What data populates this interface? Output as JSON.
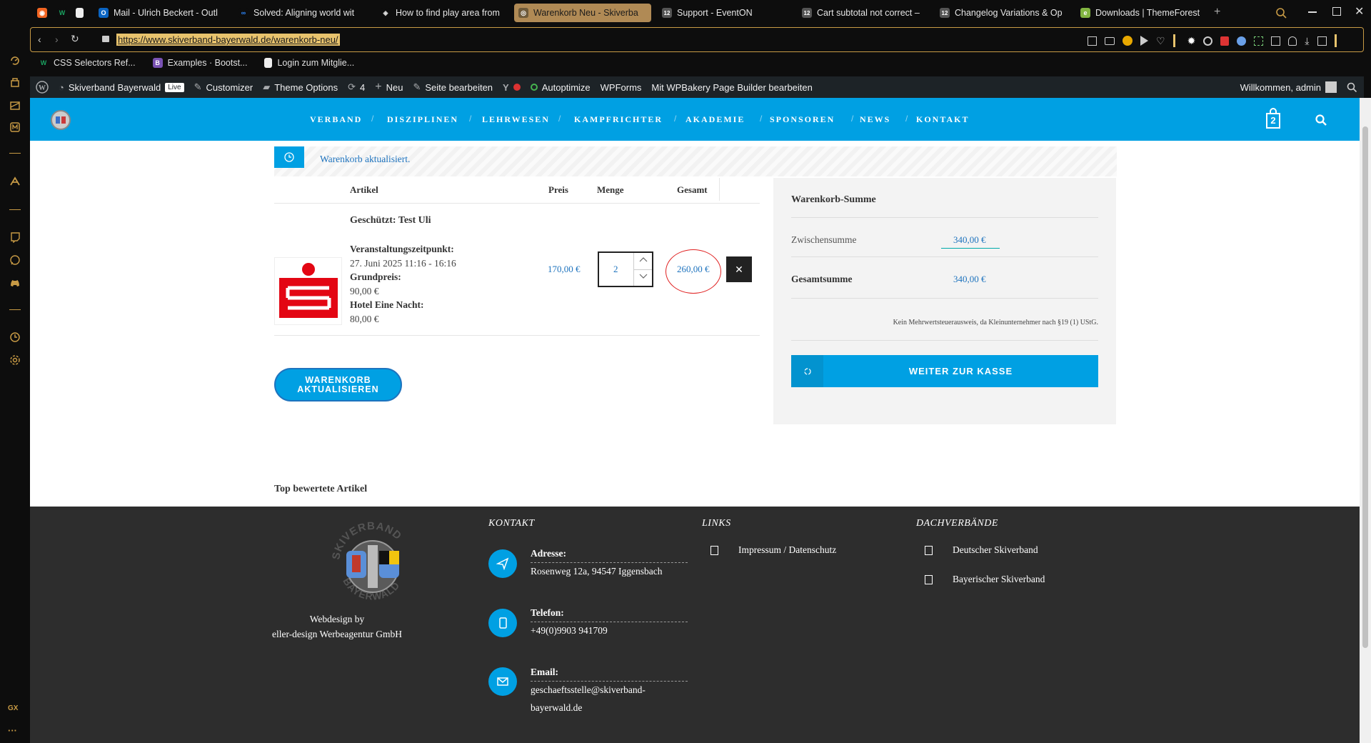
{
  "browser": {
    "tabs": [
      {
        "label": ""
      },
      {
        "label": ""
      },
      {
        "label": ""
      },
      {
        "label": "Mail - Ulrich Beckert - Outl"
      },
      {
        "label": "Solved: Aligning world wit"
      },
      {
        "label": "How to find play area from"
      },
      {
        "label": "Warenkorb Neu - Skiverba"
      },
      {
        "label": "Support - EventON"
      },
      {
        "label": "Cart subtotal not correct –"
      },
      {
        "label": "Changelog Variations & Op"
      },
      {
        "label": "Downloads | ThemeForest"
      }
    ],
    "url": "https://www.skiverband-bayerwald.de/warenkorb-neu/",
    "bookmarks": [
      "CSS Selectors Ref...",
      "Examples · Bootst...",
      "Login zum Mitglie..."
    ],
    "sidebar_gx": "GX",
    "sidebar_more": "···"
  },
  "wpbar": {
    "site": "Skiverband Bayerwald",
    "live": "Live",
    "customizer": "Customizer",
    "theme_options": "Theme Options",
    "updates": "4",
    "new": "Neu",
    "edit_page": "Seite bearbeiten",
    "autoptimize": "Autoptimize",
    "wpforms": "WPForms",
    "wpbakery": "Mit WPBakery Page Builder bearbeiten",
    "welcome": "Willkommen, admin"
  },
  "nav": {
    "items": [
      "VERBAND",
      "DISZIPLINEN",
      "LEHRWESEN",
      "KAMPFRICHTER",
      "AKADEMIE",
      "SPONSOREN",
      "NEWS",
      "KONTAKT"
    ],
    "cart_count": "2",
    "accent": "#00a0e3"
  },
  "cart": {
    "notice": "Warenkorb aktualisiert.",
    "headers": {
      "item": "Artikel",
      "price": "Preis",
      "qty": "Menge",
      "total": "Gesamt"
    },
    "row": {
      "title": "Geschützt: Test Uli",
      "meta": [
        {
          "label": "Veranstaltungszeitpunkt:",
          "value": "27. Juni 2025 11:16 - 16:16"
        },
        {
          "label": "Grundpreis:",
          "value": "90,00 €"
        },
        {
          "label": "Hotel Eine Nacht:",
          "value": "80,00 €"
        }
      ],
      "price": "170,00 €",
      "qty": "2",
      "total": "260,00 €",
      "remove": "✕"
    },
    "update_button": [
      "WARENKORB",
      "AKTUALISIEREN"
    ],
    "top_rated": "Top bewertete Artikel"
  },
  "totals": {
    "title": "Warenkorb-Summe",
    "subtotal_label": "Zwischensumme",
    "subtotal_value": "340,00 €",
    "total_label": "Gesamtsumme",
    "total_value": "340,00 €",
    "tax_note": "Kein Mehrwertsteuerausweis, da Kleinunternehmer nach §19 (1) UStG.",
    "checkout": "WEITER ZUR KASSE"
  },
  "footer": {
    "credit_1": "Webdesign by",
    "credit_2": "eller-design Werbeagentur GmbH",
    "logo_text_top": "SKIVERBAND",
    "logo_text_bottom": "BAYERWALD",
    "contact_head": "KONTAKT",
    "address_label": "Adresse:",
    "address": "Rosenweg 12a, 94547 Iggensbach",
    "phone_label": "Telefon:",
    "phone": "+49(0)9903 941709",
    "email_label": "Email:",
    "email_1": "geschaeftsstelle@skiverband-",
    "email_2": "bayerwald.de",
    "links_head": "LINKS",
    "links": [
      "Impressum / Datenschutz"
    ],
    "dach_head": "DACHVERBÄNDE",
    "dach": [
      "Deutscher Skiverband",
      "Bayerischer Skiverband"
    ]
  }
}
